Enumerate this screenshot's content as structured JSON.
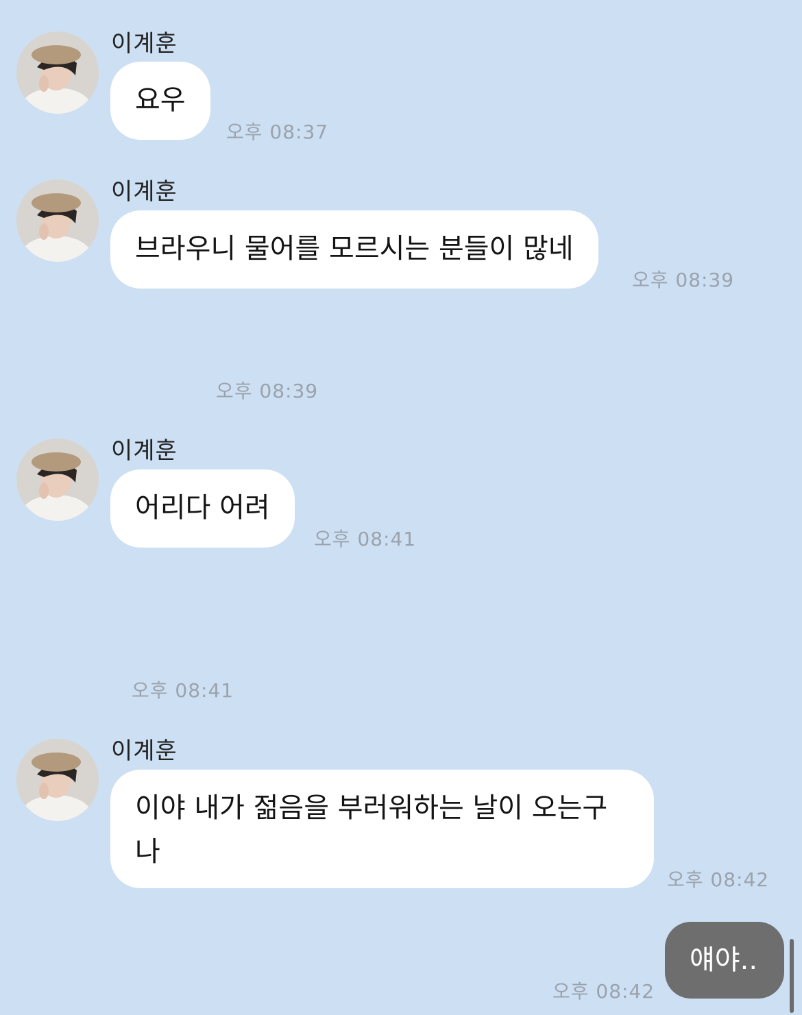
{
  "chat": {
    "messages": [
      {
        "sender": "이계훈",
        "text": "요우",
        "time": "오후 08:37"
      },
      {
        "sender": "이계훈",
        "text": "브라우니 물어를 모르시는 분들이 많네",
        "time": "오후 08:39"
      },
      {
        "sender": "이계훈",
        "text": "어리다 어려",
        "time": "오후 08:41"
      },
      {
        "sender": "이계훈",
        "text": "이야 내가 젊음을 부러워하는 날이 오는구나",
        "time": "오후 08:42"
      }
    ],
    "hidden_times": [
      "오후 08:39",
      "오후 08:41"
    ],
    "my_message": {
      "text": "얘야..",
      "time": "오후 08:42"
    }
  },
  "colors": {
    "background": "#cddff3",
    "incoming_bubble": "#ffffff",
    "outgoing_bubble": "#6e6e6e",
    "timestamp": "#9aa3ad"
  },
  "icons": {
    "avatar": "profile-photo"
  }
}
